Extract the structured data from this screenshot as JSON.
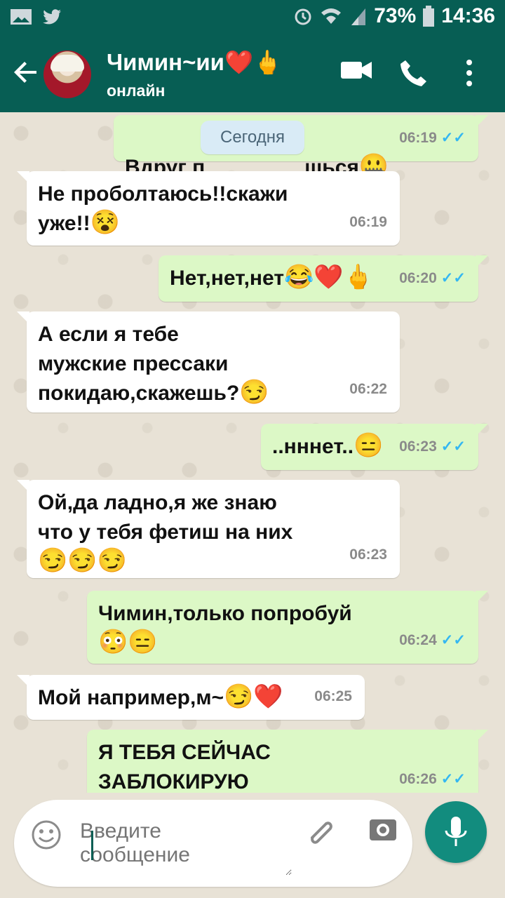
{
  "status_bar": {
    "battery": "73%",
    "time": "14:36"
  },
  "header": {
    "contact_name": "Чимин~ии",
    "contact_emoji": "❤️🖕",
    "status": "онлайн",
    "icons": [
      "back-arrow-icon",
      "video-call-icon",
      "phone-call-icon",
      "more-vertical-icon"
    ]
  },
  "chat": {
    "date_separator": "Сегодня",
    "messages": [
      {
        "direction": "out",
        "text": "Вдруг п",
        "text_after": "шься",
        "emoji": "🤐",
        "time": "06:19",
        "read": "✓✓"
      },
      {
        "direction": "in",
        "text": "Не проболтаюсь!!скажи\nуже!!",
        "emoji": "😵",
        "time": "06:19"
      },
      {
        "direction": "out",
        "text": "Нет,нет,нет",
        "emoji": "😂❤️🖕",
        "time": "06:20",
        "read": "✓✓"
      },
      {
        "direction": "in",
        "text": "А если я тебе\nмужские прессаки\nпокидаю,скажешь?",
        "emoji": "😏",
        "time": "06:22"
      },
      {
        "direction": "out",
        "text": "..нннет..",
        "emoji": "😑",
        "time": "06:23",
        "read": "✓✓"
      },
      {
        "direction": "in",
        "text": "Ой,да ладно,я же знаю\nчто у тебя фетиш на них",
        "emoji": "😏😏😏",
        "time": "06:23"
      },
      {
        "direction": "out",
        "text": "Чимин,только попробуй",
        "emoji": "😳😑",
        "time": "06:24",
        "read": "✓✓"
      },
      {
        "direction": "in",
        "text": "Мой например,м~",
        "emoji": "😏❤️",
        "time": "06:25"
      },
      {
        "direction": "out",
        "text": "Я ТЕБЯ СЕЙЧАС\nЗАБЛОКИРУЮ",
        "time": "06:26",
        "read": "✓✓"
      }
    ]
  },
  "composer": {
    "placeholder": "Введите\nсообщение",
    "icons": [
      "emoji-icon",
      "attachment-icon",
      "camera-icon",
      "microphone-icon"
    ]
  },
  "colors": {
    "header": "#075e54",
    "outgoing_bubble": "#dcf8c6",
    "incoming_bubble": "#ffffff",
    "accent": "#128c7e",
    "read_checks": "#34b7f1"
  }
}
